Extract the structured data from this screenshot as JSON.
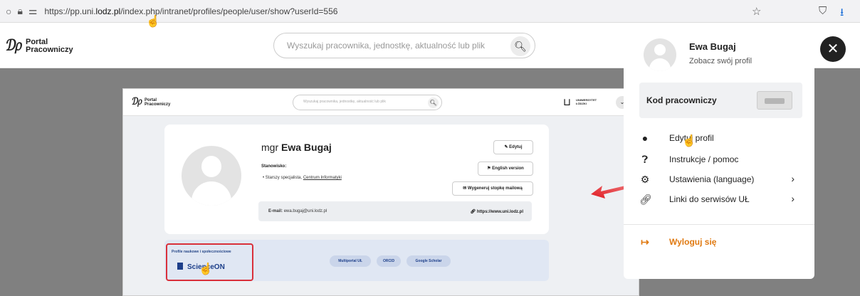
{
  "browser": {
    "url_host": "https://pp.uni.",
    "url_bold": "lodz.pl",
    "url_path": "/index.php/intranet/profiles/people/user/show?userId=556"
  },
  "header": {
    "logo": "Portal\nPracowniczy",
    "search_placeholder": "Wyszukaj pracownika, jednostkę, aktualność lub plik"
  },
  "profile_card": {
    "title_prefix": "mgr",
    "name": "Ewa Bugaj",
    "position_label": "Stanowisko:",
    "position_value": "Starszy specjalista,",
    "position_unit": "Centrum Informatyki",
    "buttons": {
      "edit": "Edytuj",
      "english": "English version",
      "signature": "Wygeneruj stopkę mailową"
    },
    "email_label": "E-mail:",
    "email": "ewa.bugaj@uni.lodz.pl",
    "website": "https://www.uni.lodz.pl"
  },
  "university": {
    "name": "UNIWERSYTET\nŁÓDZKI"
  },
  "profiles_section": {
    "title": "Profile naukowe i społecznościowe",
    "scienceon": "ScienceON",
    "links": [
      "Multiportal UŁ",
      "ORCID",
      "Google Scholar"
    ]
  },
  "user_panel": {
    "name": "Ewa Bugaj",
    "subtitle": "Zobacz swój profil",
    "kod_label": "Kod pracowniczy",
    "menu": [
      {
        "label": "Edytuj profil",
        "icon": "user-icon"
      },
      {
        "label": "Instrukcje / pomoc",
        "icon": "help-icon"
      },
      {
        "label": "Ustawienia (language)",
        "icon": "gear-icon"
      },
      {
        "label": "Linki do serwisów UŁ",
        "icon": "link-icon"
      }
    ],
    "logout": "Wyloguj się",
    "accent_color": "#e07a12"
  },
  "annotations": {
    "highlight_color": "#d9303a"
  }
}
